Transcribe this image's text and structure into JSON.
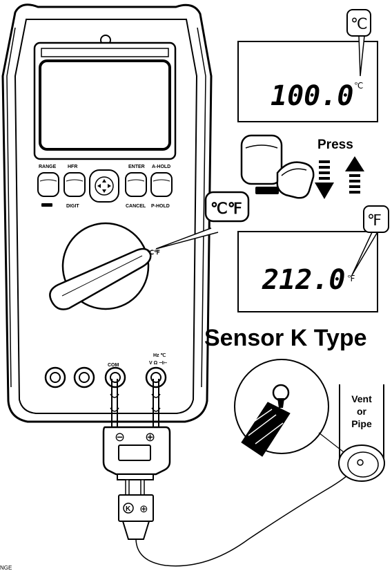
{
  "meter": {
    "keys": {
      "range": "RANGE",
      "hfr": "HFR",
      "enter": "ENTER",
      "a_hold": "A-HOLD",
      "digit": "DIGIT",
      "cancel": "CANCEL",
      "p_hold": "P-HOLD"
    },
    "dial_label": "℃℉",
    "jacks": {
      "com": "COM",
      "func_top": "Hz ℃",
      "func_bottom": "V Ω ⊣⊢"
    },
    "plug_minus": "⊖",
    "plug_plus": "⊕"
  },
  "callout_cf": "℃℉",
  "display_c": {
    "reading": "100.0",
    "unit": "℃",
    "callout": "℃"
  },
  "press": "Press",
  "display_f": {
    "reading": "212.0",
    "unit": "℉",
    "callout": "℉"
  },
  "sensor_title": "Sensor K Type",
  "vent_label": [
    "Vent",
    "or",
    "Pipe"
  ],
  "connector": {
    "k": "K",
    "plus": "⊕"
  },
  "edge_text": "NGE"
}
